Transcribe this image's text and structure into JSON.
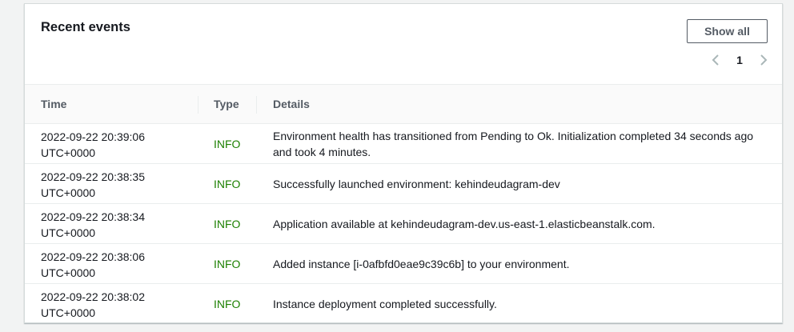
{
  "panel": {
    "title": "Recent events",
    "show_all_label": "Show all",
    "pagination": {
      "current_page": "1"
    }
  },
  "table": {
    "columns": [
      "Time",
      "Type",
      "Details"
    ],
    "rows": [
      {
        "time_date": "2022-09-22 20:39:06",
        "time_zone": "UTC+0000",
        "type": "INFO",
        "details": "Environment health has transitioned from Pending to Ok. Initialization completed 34 seconds ago and took 4 minutes."
      },
      {
        "time_date": "2022-09-22 20:38:35",
        "time_zone": "UTC+0000",
        "type": "INFO",
        "details": "Successfully launched environment: kehindeudagram-dev"
      },
      {
        "time_date": "2022-09-22 20:38:34",
        "time_zone": "UTC+0000",
        "type": "INFO",
        "details": "Application available at kehindeudagram-dev.us-east-1.elasticbeanstalk.com."
      },
      {
        "time_date": "2022-09-22 20:38:06",
        "time_zone": "UTC+0000",
        "type": "INFO",
        "details": "Added instance [i-0afbfd0eae9c39c6b] to your environment."
      },
      {
        "time_date": "2022-09-22 20:38:02",
        "time_zone": "UTC+0000",
        "type": "INFO",
        "details": "Instance deployment completed successfully."
      }
    ]
  },
  "colors": {
    "info_type": "#1d8102",
    "header_bg": "#fafafa",
    "border": "#eaeded",
    "page_bg": "#f2f3f3"
  },
  "icons": {
    "prev": "chevron-left-icon",
    "next": "chevron-right-icon"
  }
}
